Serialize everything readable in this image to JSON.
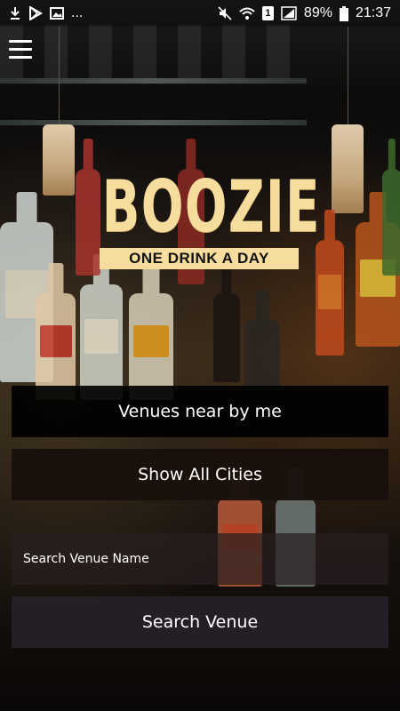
{
  "status_bar": {
    "battery": "89%",
    "time": "21:37",
    "notification_count": "1",
    "more": "..."
  },
  "logo": {
    "title": "BOOZIE",
    "tagline": "ONE DRINK A DAY"
  },
  "actions": {
    "venues_near_label": "Venues near by me",
    "show_all_cities_label": "Show All Cities",
    "search_button_label": "Search Venue"
  },
  "search": {
    "placeholder": "Search Venue Name",
    "value": ""
  },
  "colors": {
    "brand": "#f6dc9d",
    "button_dark": "#000000",
    "button_brown": "#18100c",
    "button_purple": "#262028"
  }
}
